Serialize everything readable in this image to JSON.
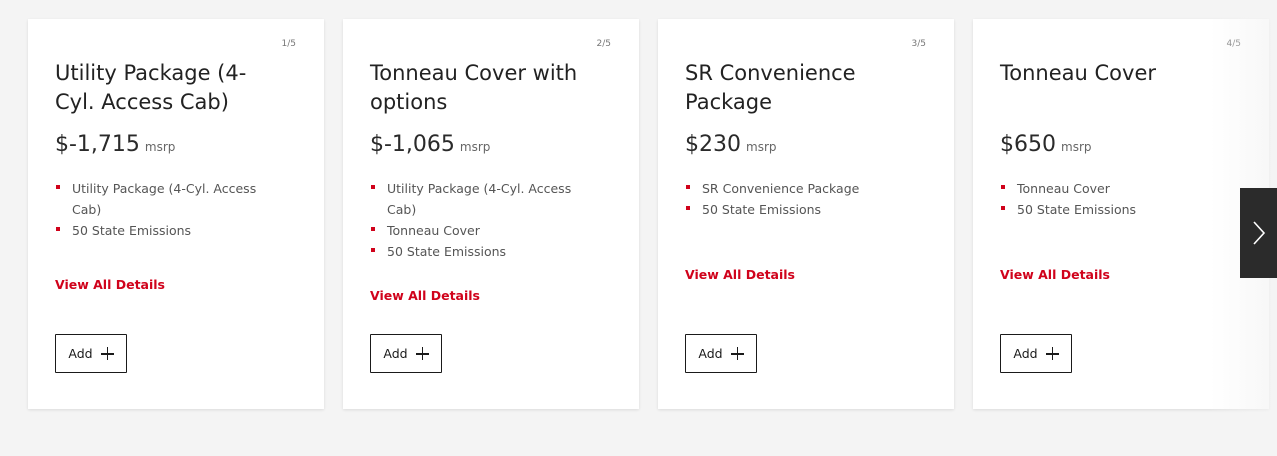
{
  "cards": [
    {
      "counter": "1/5",
      "title": "Utility Package (4-Cyl. Access Cab)",
      "price": "$-1,715",
      "price_unit": "msrp",
      "features": [
        "Utility Package (4-Cyl. Access Cab)",
        "50 State Emissions"
      ],
      "details_label": "View All Details",
      "add_label": "Add"
    },
    {
      "counter": "2/5",
      "title": "Tonneau Cover with options",
      "price": "$-1,065",
      "price_unit": "msrp",
      "features": [
        "Utility Package (4-Cyl. Access Cab)",
        "Tonneau Cover",
        "50 State Emissions"
      ],
      "details_label": "View All Details",
      "add_label": "Add"
    },
    {
      "counter": "3/5",
      "title": "SR Convenience Package",
      "price": "$230",
      "price_unit": "msrp",
      "features": [
        "SR Convenience Package",
        "50 State Emissions"
      ],
      "details_label": "View All Details",
      "add_label": "Add"
    },
    {
      "counter": "4/5",
      "title": "Tonneau Cover",
      "price": "$650",
      "price_unit": "msrp",
      "features": [
        "Tonneau Cover",
        "50 State Emissions"
      ],
      "details_label": "View All Details",
      "add_label": "Add"
    }
  ],
  "navigation": {
    "next_icon": "chevron-right-icon"
  },
  "colors": {
    "accent": "#d0021b",
    "background": "#f4f4f4",
    "card": "#ffffff",
    "nav_button": "#2b2b2b"
  }
}
